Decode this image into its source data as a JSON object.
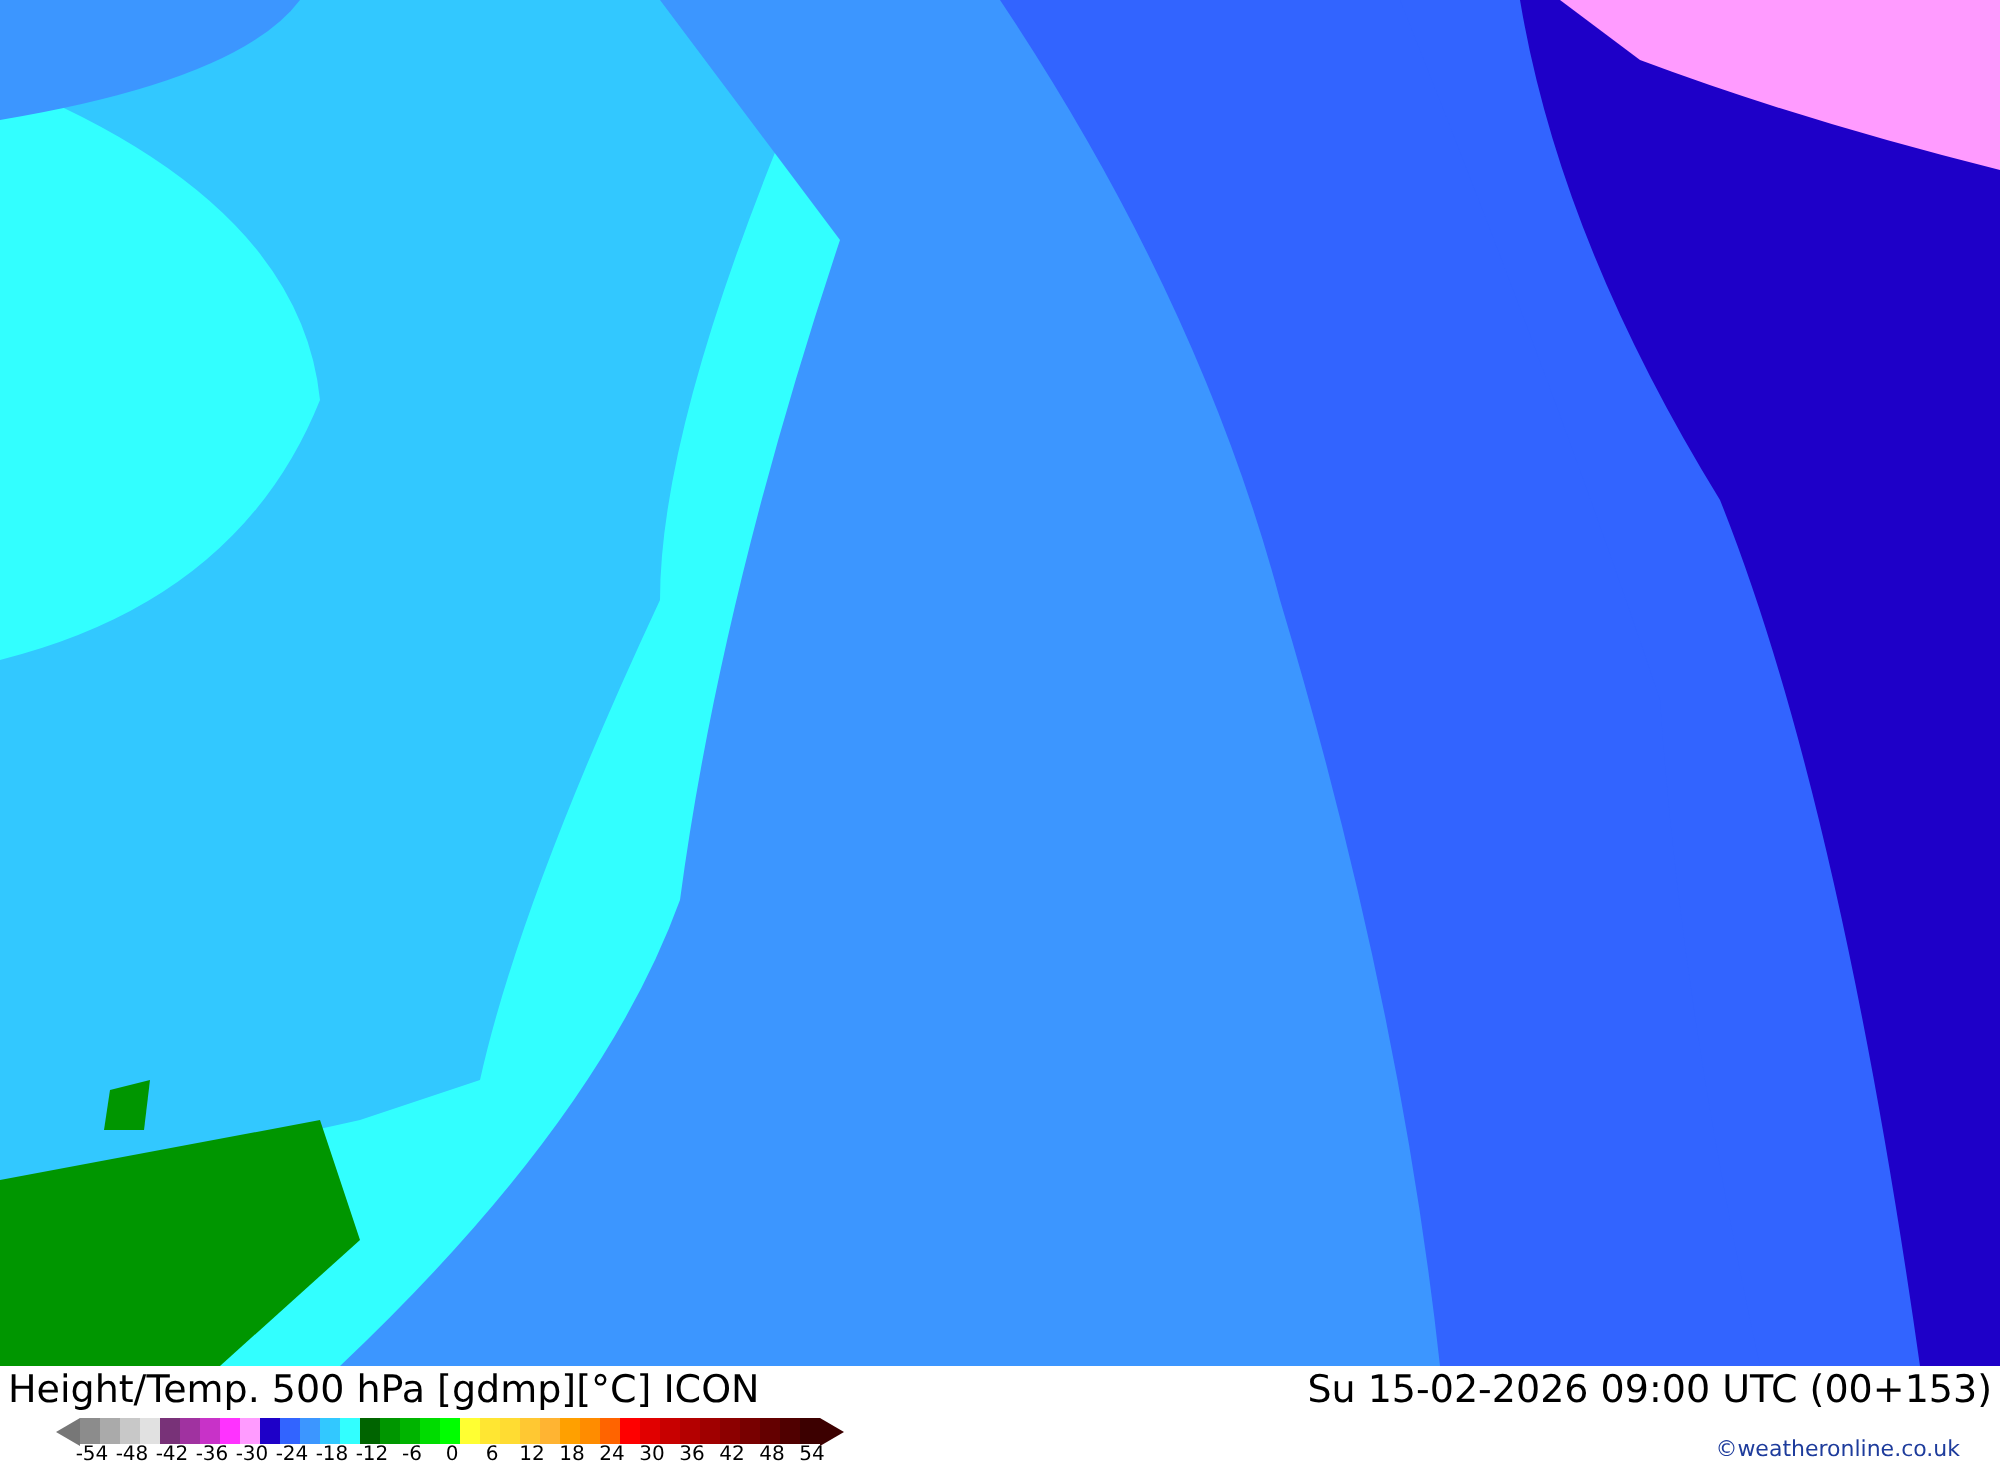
{
  "map": {
    "kind": "temperature-map"
  },
  "footer": {
    "title": "Height/Temp. 500 hPa [gdmp][°C] ICON",
    "datetime": "Su 15-02-2026 09:00 UTC (00+153)",
    "credit": "©weatheronline.co.uk"
  },
  "legend": {
    "swatches": [
      {
        "color": "#8c8c8c"
      },
      {
        "color": "#aaaaaa"
      },
      {
        "color": "#c8c8c8"
      },
      {
        "color": "#e1e1e1"
      },
      {
        "color": "#783278"
      },
      {
        "color": "#a032a0"
      },
      {
        "color": "#c832c8"
      },
      {
        "color": "#ff32ff"
      },
      {
        "color": "#ff9bff"
      },
      {
        "color": "#1e00c8"
      },
      {
        "color": "#3264ff"
      },
      {
        "color": "#3c96ff"
      },
      {
        "color": "#32c8ff"
      },
      {
        "color": "#32ffff"
      },
      {
        "color": "#006400"
      },
      {
        "color": "#009600"
      },
      {
        "color": "#00b400"
      },
      {
        "color": "#00dc00"
      },
      {
        "color": "#00ff00"
      },
      {
        "color": "#ffff32"
      },
      {
        "color": "#ffe632"
      },
      {
        "color": "#ffdc32"
      },
      {
        "color": "#ffc832"
      },
      {
        "color": "#ffb432"
      },
      {
        "color": "#ffa000"
      },
      {
        "color": "#ff8c00"
      },
      {
        "color": "#ff6400"
      },
      {
        "color": "#ff0000"
      },
      {
        "color": "#e10000"
      },
      {
        "color": "#c80000"
      },
      {
        "color": "#b40000"
      },
      {
        "color": "#a00000"
      },
      {
        "color": "#8c0000"
      },
      {
        "color": "#780000"
      },
      {
        "color": "#640000"
      },
      {
        "color": "#500000"
      },
      {
        "color": "#3c0000"
      }
    ],
    "ticks": [
      "-54",
      "-48",
      "-42",
      "-36",
      "-30",
      "-24",
      "-18",
      "-12",
      "-6",
      "0",
      "6",
      "12",
      "18",
      "24",
      "30",
      "36",
      "42",
      "48",
      "54"
    ]
  }
}
